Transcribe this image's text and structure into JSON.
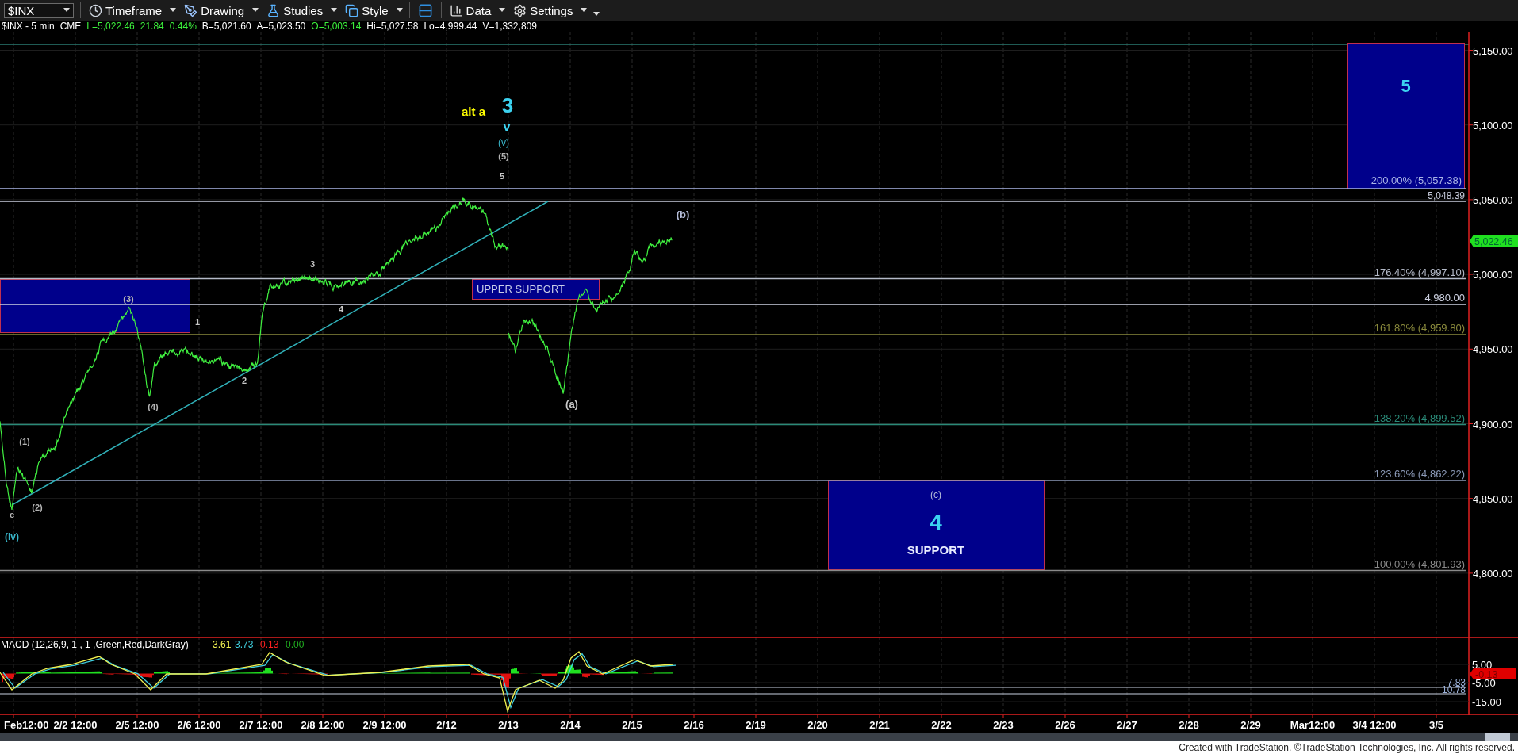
{
  "toolbar": {
    "symbol": "$INX",
    "items": [
      {
        "kind": "timeframe",
        "label": "Timeframe"
      },
      {
        "kind": "drawing",
        "label": "Drawing"
      },
      {
        "kind": "studies",
        "label": "Studies"
      },
      {
        "kind": "style",
        "label": "Style"
      },
      {
        "kind": "layout"
      },
      {
        "kind": "data",
        "label": "Data"
      },
      {
        "kind": "settings",
        "label": "Settings"
      }
    ]
  },
  "quote_line": [
    {
      "text": "$INX - 5 min",
      "color": "#ffffff"
    },
    {
      "text": "CME",
      "color": "#ffffff"
    },
    {
      "text": "L=5,022.46",
      "color": "#3cf03c"
    },
    {
      "text": "21.84",
      "color": "#3cf03c"
    },
    {
      "text": "0.44%",
      "color": "#3cf03c"
    },
    {
      "text": "B=5,021.60",
      "color": "#ffffff"
    },
    {
      "text": "A=5,023.50",
      "color": "#ffffff"
    },
    {
      "text": "O=5,003.14",
      "color": "#3cf03c"
    },
    {
      "text": "Hi=5,027.58",
      "color": "#ffffff"
    },
    {
      "text": "Lo=4,999.44",
      "color": "#ffffff"
    },
    {
      "text": "V=1,332,809",
      "color": "#ffffff"
    }
  ],
  "price_axis": {
    "ticks": [
      "5,150.00",
      "5,100.00",
      "5,050.00",
      "5,000.00",
      "4,950.00",
      "4,900.00",
      "4,850.00",
      "4,800.00"
    ],
    "last_price": "5,022.46"
  },
  "levels": [
    {
      "label": "200.00% (5,057.38)",
      "color": "#aab4e6"
    },
    {
      "label": "5,048.39",
      "color": "#c8ccdc"
    },
    {
      "label": "176.40% (4,997.10)",
      "color": "#b4bac8"
    },
    {
      "label": "4,980.00",
      "color": "#ccd0e0"
    },
    {
      "label": "161.80% (4,959.80)",
      "color": "#8a8a3c"
    },
    {
      "label": "138.20% (4,899.52)",
      "color": "#2a8a78"
    },
    {
      "label": "123.60% (4,862.22)",
      "color": "#8c9ab8"
    },
    {
      "label": "100.00% (4,801.93)",
      "color": "#8a8a8a"
    }
  ],
  "zones": [
    {
      "kind": "target",
      "number": "5"
    },
    {
      "kind": "plain"
    },
    {
      "kind": "labelled",
      "caption": "UPPER SUPPORT"
    },
    {
      "kind": "support",
      "wave": "(c)",
      "number": "4",
      "caption": "SUPPORT"
    }
  ],
  "wave_labels": [
    {
      "text": "alt a",
      "color": "#ffff00"
    },
    {
      "text": "3",
      "color": "#3cd2f0"
    },
    {
      "text": "v",
      "color": "#3cd2f0"
    },
    {
      "text": "(v)",
      "color": "#38b4c8"
    },
    {
      "text": "(5)",
      "color": "#b4b4b4"
    },
    {
      "text": "5",
      "color": "#c8c8c8"
    },
    {
      "text": "(b)",
      "color": "#b4bcd8"
    },
    {
      "text": "3",
      "color": "#c8c8c8"
    },
    {
      "text": "(3)",
      "color": "#b4b4b4"
    },
    {
      "text": "1",
      "color": "#c8c8c8"
    },
    {
      "text": "4",
      "color": "#c8c8c8"
    },
    {
      "text": "2",
      "color": "#c8c8c8"
    },
    {
      "text": "(4)",
      "color": "#b4b4b4"
    },
    {
      "text": "(a)",
      "color": "#c8c8c8"
    },
    {
      "text": "(1)",
      "color": "#b4b4b4"
    },
    {
      "text": "(2)",
      "color": "#b4b4b4"
    },
    {
      "text": "c",
      "color": "#b4b4b4"
    },
    {
      "text": "(iv)",
      "color": "#38b4c8"
    }
  ],
  "macd": {
    "title": "MACD (12,26,9, 1 , 1 ,Green,Red,DarkGray)",
    "values": [
      {
        "text": "3.61",
        "color": "#f0f050"
      },
      {
        "text": "3.73",
        "color": "#40d0e0"
      },
      {
        "text": "-0.13",
        "color": "#ff2020"
      },
      {
        "text": "0.00",
        "color": "#20b020"
      }
    ],
    "ticks": [
      "5.00",
      "-5.00",
      "-15.00"
    ],
    "last": "-0.13",
    "line_labels": [
      "7.83",
      "10.78"
    ]
  },
  "date_axis": [
    "Feb12:00",
    "2/2 12:00",
    "2/5 12:00",
    "2/6 12:00",
    "2/7 12:00",
    "2/8 12:00",
    "2/9 12:00",
    "2/12",
    "2/13",
    "2/14",
    "2/15",
    "2/16",
    "2/19",
    "2/20",
    "2/21",
    "2/22",
    "2/23",
    "2/26",
    "2/27",
    "2/28",
    "2/29",
    "Mar12:00",
    "3/4 12:00",
    "3/5"
  ],
  "footer": "Created with TradeStation. ©TradeStation Technologies, Inc. All rights reserved."
}
